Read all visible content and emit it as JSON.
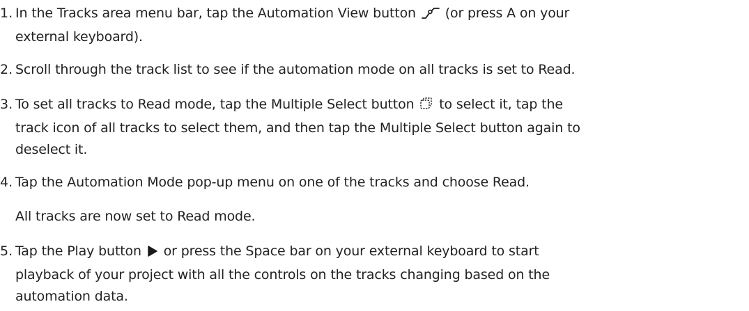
{
  "steps": [
    {
      "number": "1.",
      "lines": [
        {
          "before": "In the Tracks area menu bar, tap the Automation View button",
          "icon": "automation-view-icon",
          "after": "(or press A on your"
        },
        {
          "text": "external keyboard)."
        }
      ]
    },
    {
      "number": "2.",
      "lines": [
        {
          "text": "Scroll through the track list to see if the automation mode on all tracks is set to Read."
        }
      ]
    },
    {
      "number": "3.",
      "lines": [
        {
          "before": "To set all tracks to Read mode, tap the Multiple Select button",
          "icon": "multiple-select-icon",
          "after": "to select it, tap the"
        },
        {
          "text": "track icon of all tracks to select them, and then tap the Multiple Select button  again to"
        },
        {
          "text": "deselect it."
        }
      ]
    },
    {
      "number": "4.",
      "lines": [
        {
          "text": "Tap the Automation Mode pop-up menu on one of the tracks and choose Read."
        }
      ],
      "note": "All tracks are now set to Read mode."
    },
    {
      "number": "5.",
      "lines": [
        {
          "before": "Tap the Play button",
          "icon": "play-icon",
          "after": "or press the Space bar on your external keyboard to start"
        },
        {
          "text": "playback of your project with all the controls on the tracks changing based on the"
        },
        {
          "text": "automation data."
        }
      ]
    }
  ]
}
